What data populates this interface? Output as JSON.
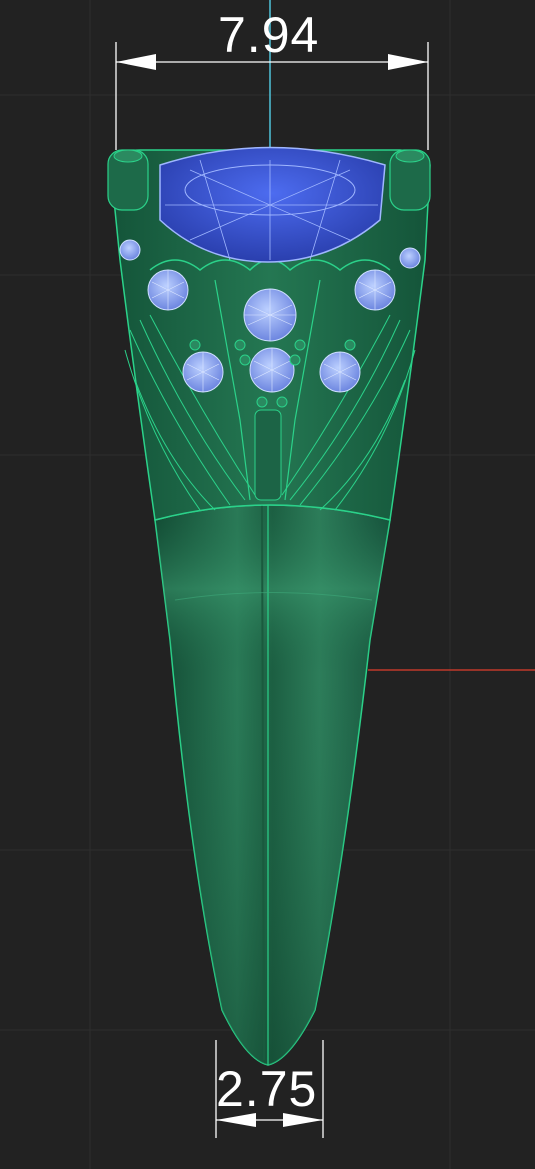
{
  "viewport": {
    "background": "#222222",
    "grid_color": "#2e2e2e"
  },
  "axes": {
    "vertical_axis_color": "#4fc3d9",
    "horizontal_axis_color": "#c0392b"
  },
  "model": {
    "body_color": "#1f6b4a",
    "edge_color": "#2bd28a",
    "gem_color": "#3a5be0",
    "gem_wire_color": "#9fb6ff",
    "stone_color": "#8ea4f0"
  },
  "dimensions": {
    "top": {
      "value": "7.94",
      "color": "#ffffff"
    },
    "bottom": {
      "value": "2.75",
      "color": "#ffffff"
    }
  }
}
